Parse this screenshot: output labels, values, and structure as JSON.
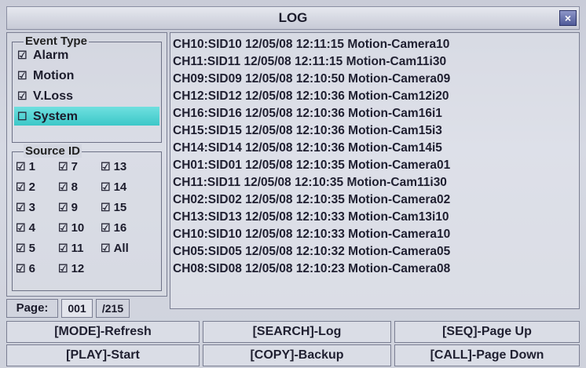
{
  "window": {
    "title": "LOG",
    "close_label": "×"
  },
  "event_type": {
    "legend": "Event Type",
    "check_glyph": "☑",
    "uncheck_glyph": "☐",
    "items": [
      {
        "label": "Alarm",
        "checked": true
      },
      {
        "label": "Motion",
        "checked": true
      },
      {
        "label": "V.Loss",
        "checked": true
      },
      {
        "label": "System",
        "checked": false,
        "selected": true
      }
    ]
  },
  "source_id": {
    "legend": "Source ID",
    "check_glyph": "☑",
    "items": [
      "1",
      "7",
      "13",
      "2",
      "8",
      "14",
      "3",
      "9",
      "15",
      "4",
      "10",
      "16",
      "5",
      "11",
      "All",
      "6",
      "12"
    ]
  },
  "pager": {
    "label": "Page:",
    "current": "001",
    "total": "/215"
  },
  "log_entries": [
    "CH10:SID10 12/05/08 12:11:15 Motion-Camera10",
    "CH11:SID11 12/05/08 12:11:15 Motion-Cam11i30",
    "CH09:SID09 12/05/08 12:10:50 Motion-Camera09",
    "CH12:SID12 12/05/08 12:10:36 Motion-Cam12i20",
    "CH16:SID16 12/05/08 12:10:36 Motion-Cam16i1",
    "CH15:SID15 12/05/08 12:10:36 Motion-Cam15i3",
    "CH14:SID14 12/05/08 12:10:36 Motion-Cam14i5",
    "CH01:SID01 12/05/08 12:10:35 Motion-Camera01",
    "CH11:SID11 12/05/08 12:10:35 Motion-Cam11i30",
    "CH02:SID02 12/05/08 12:10:35 Motion-Camera02",
    "CH13:SID13 12/05/08 12:10:33 Motion-Cam13i10",
    "CH10:SID10 12/05/08 12:10:33 Motion-Camera10",
    "CH05:SID05 12/05/08 12:10:32 Motion-Camera05",
    "CH08:SID08 12/05/08 12:10:23 Motion-Camera08"
  ],
  "buttons": {
    "refresh": "[MODE]-Refresh",
    "search": "[SEARCH]-Log",
    "page_up": "[SEQ]-Page Up",
    "start": "[PLAY]-Start",
    "backup": "[COPY]-Backup",
    "page_down": "[CALL]-Page Down"
  },
  "colors": {
    "selected_highlight": "#4fd2d2",
    "close_button": "#5b66a8"
  }
}
